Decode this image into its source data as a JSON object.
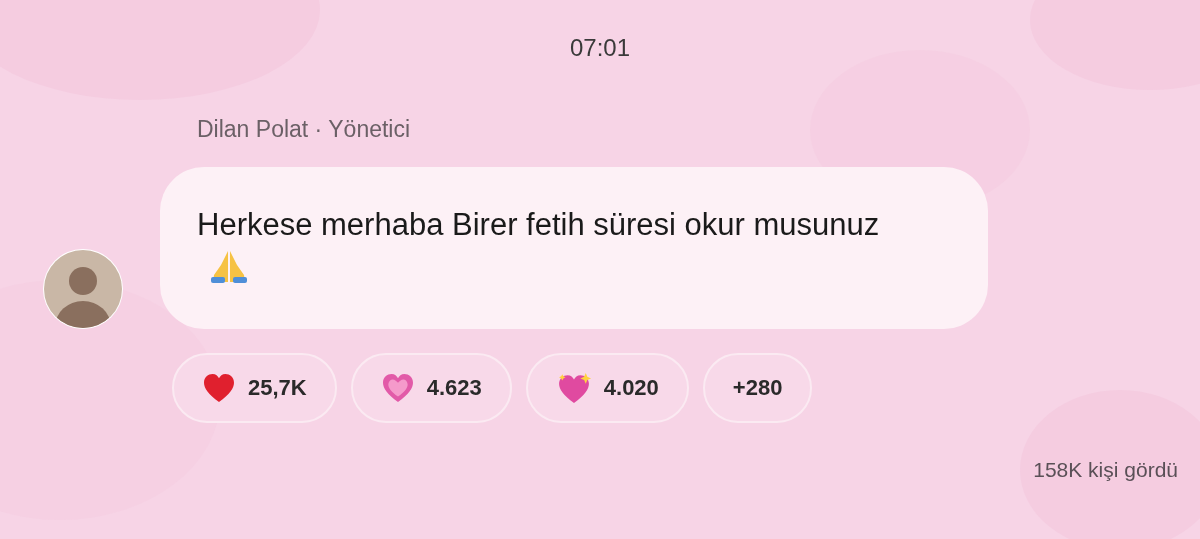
{
  "time": "07:01",
  "message": {
    "sender": "Dilan Polat · Yönetici",
    "text": "Herkese merhaba Birer fetih süresi okur musunuz"
  },
  "reactions": [
    {
      "kind": "red_heart",
      "count": "25,7K"
    },
    {
      "kind": "pink_heart",
      "count": "4.623"
    },
    {
      "kind": "sparkling_heart",
      "count": "4.020"
    },
    {
      "kind": "more",
      "count": "+280"
    }
  ],
  "views": "158K kişi gördü"
}
